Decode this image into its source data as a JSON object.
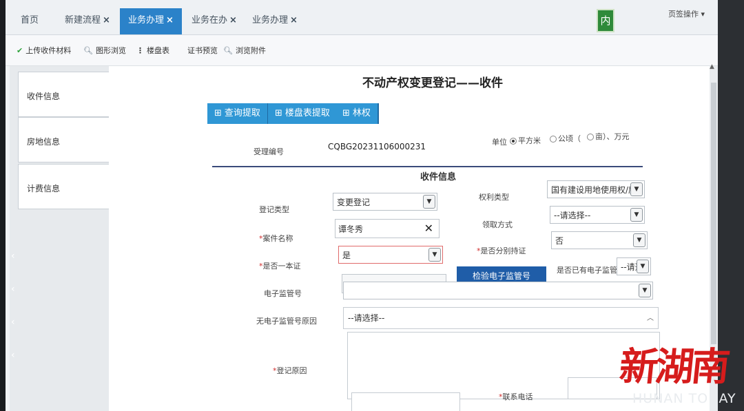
{
  "tabs": [
    {
      "label": "首页",
      "closable": false,
      "active": false
    },
    {
      "label": "新建流程",
      "closable": true,
      "active": false
    },
    {
      "label": "业务办理",
      "closable": true,
      "active": true
    },
    {
      "label": "业务在办",
      "closable": true,
      "active": false
    },
    {
      "label": "业务办理",
      "closable": true,
      "active": false
    }
  ],
  "close_glyph": "×",
  "nei_badge": "内",
  "page_ops": "页签操作",
  "toolbar": {
    "upload": "上传收件材料",
    "graph_view": "图形浏览",
    "building_table": "楼盘表",
    "cert_preview": "证书预览",
    "browse_attach": "浏览附件"
  },
  "sidebar": {
    "items": [
      {
        "label": "收件信息"
      },
      {
        "label": "房地信息"
      },
      {
        "label": "计费信息"
      }
    ]
  },
  "form": {
    "title": "不动产权变更登记——收件",
    "buttons": {
      "query_fetch": "查询提取",
      "building_fetch": "楼盘表提取",
      "forest": "林权"
    },
    "accept_no_label": "受理编号",
    "accept_no": "CQBG20231106000231",
    "unit_label": "单位",
    "unit_sqm": "平方米",
    "unit_hectare": "公顷（",
    "unit_mu": "亩）、万元",
    "section_title": "收件信息",
    "reg_type_label": "登记类型",
    "reg_type_value": "变更登记",
    "right_type_label": "权利类型",
    "right_type_value": "国有建设用地使用权/房屋（",
    "case_name_label": "案件名称",
    "case_name_value": "谭冬秀",
    "receive_method_label": "领取方式",
    "receive_method_value": "--请选择--",
    "one_cert_label": "是否一本证",
    "one_cert_value": "是",
    "separate_cert_label": "是否分别持证",
    "separate_cert_value": "否",
    "verify_button": "检验电子监管号",
    "has_e_sup_label": "是否已有电子监管号",
    "has_e_sup_value": "--请选择",
    "e_sup_label": "电子监管号",
    "no_e_sup_reason_label": "无电子监管号原因",
    "no_e_sup_reason_value": "--请选择--",
    "reg_reason_label": "登记原因",
    "contact_phone_label": "联系电话",
    "required_mark": "*"
  },
  "watermark": {
    "main": "新湖南",
    "sub": "HUNAN TODAY"
  },
  "colors": {
    "active_tab": "#2b82c9",
    "blue_button": "#2f97d5",
    "verify_button": "#1f5da8",
    "watermark": "#d61c1c"
  }
}
